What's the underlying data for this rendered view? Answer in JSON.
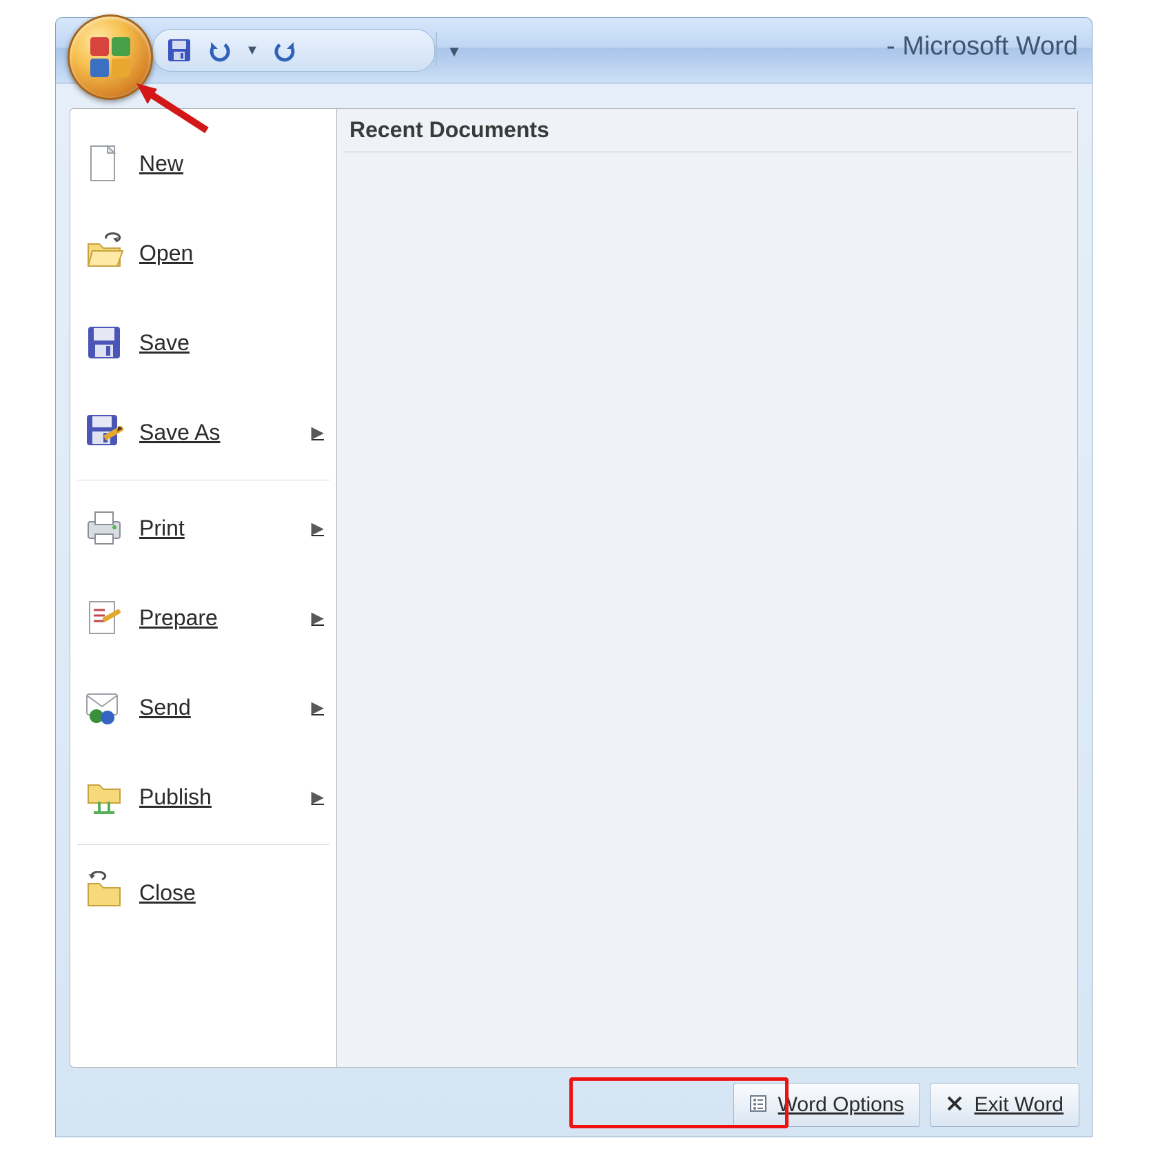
{
  "title_suffix": " - Microsoft Word",
  "recent_header": "Recent Documents",
  "menu_items": [
    {
      "label": "New",
      "submenu": false
    },
    {
      "label": "Open",
      "submenu": false
    },
    {
      "label": "Save",
      "submenu": false
    },
    {
      "label": "Save As",
      "submenu": true
    },
    {
      "label": "Print",
      "submenu": true
    },
    {
      "label": "Prepare",
      "submenu": true
    },
    {
      "label": "Send",
      "submenu": true
    },
    {
      "label": "Publish",
      "submenu": true
    },
    {
      "label": "Close",
      "submenu": false
    }
  ],
  "footer": {
    "word_options": "Word Options",
    "exit_word": "Exit Word"
  },
  "qat": {
    "save_icon": "floppy-icon",
    "undo_icon": "undo-icon",
    "redo_icon": "redo-icon"
  }
}
